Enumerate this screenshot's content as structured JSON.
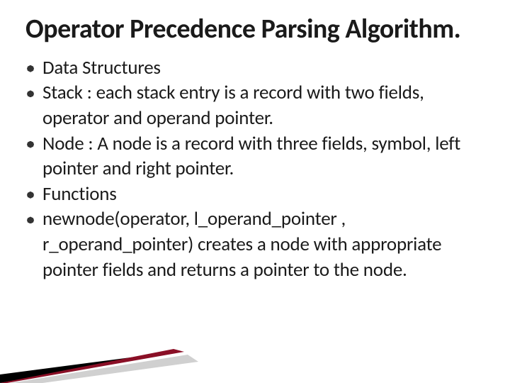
{
  "slide": {
    "title": "Operator Precedence Parsing Algorithm.",
    "bullets": [
      "Data Structures",
      "Stack : each stack entry is a record with two fields, operator and operand pointer.",
      "Node : A node is a record with three fields, symbol, left pointer and right pointer.",
      "Functions",
      "  newnode(operator, l_operand_pointer , r_operand_pointer) creates a node with appropriate pointer fields and returns a pointer to the node."
    ]
  }
}
